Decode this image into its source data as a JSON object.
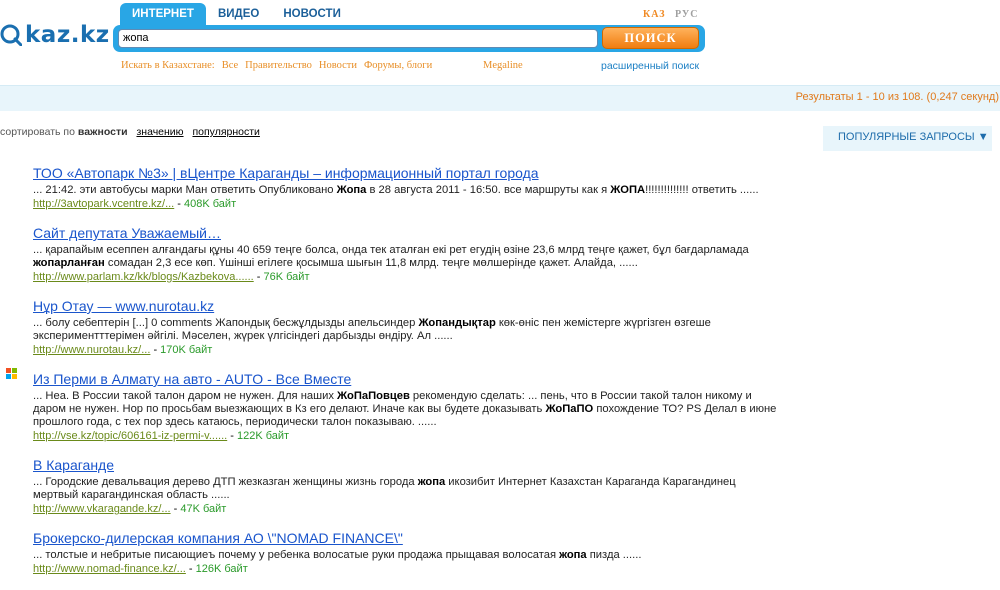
{
  "logo": {
    "text": "kaz.kz"
  },
  "tabs": [
    {
      "label": "ИНТЕРНЕТ",
      "active": true
    },
    {
      "label": "ВИДЕО",
      "active": false
    },
    {
      "label": "НОВОСТИ",
      "active": false
    }
  ],
  "languages": {
    "kaz": "КАЗ",
    "rus": "РУС"
  },
  "search": {
    "value": "жопа",
    "button_label": "ПОИСК"
  },
  "scope": {
    "prefix": "Искать в Казахстане:",
    "options": [
      "Все",
      "Правительство",
      "Новости",
      "Форумы, блоги"
    ],
    "megaline": "Megaline",
    "advanced": "расширенный поиск"
  },
  "results_info": "Результаты 1 - 10 из 108. (0,247 секунд)",
  "sort": {
    "prefix": "сортировать по",
    "current": "важности",
    "options": [
      "значению",
      "популярности"
    ]
  },
  "popular_queries": "ПОПУЛЯРНЫЕ ЗАПРОСЫ ▼",
  "results": [
    {
      "title": "ТОО «Автопарк №3» | вЦентре Караганды – информационный портал города",
      "snippet_html": "... 21:42. эти автобусы марки Ман ответить Опубликовано <b>Жопа</b> в 28 августа 2011 - 16:50. все маршруты как я <b>ЖОПА</b>!!!!!!!!!!!!!! ответить ......",
      "url": "http://3avtopark.vcentre.kz/...",
      "size": "408K байт"
    },
    {
      "title": "Сайт депутата Уважаемый…",
      "snippet_html": "... қарапайым есеппен алғандағы құны 40 659 теңге болса, онда тек аталған екі рет егудің өзіне 23,6 млрд теңге қажет, бұл бағдарламада <b>жопарланған</b> сомадан 2,3 есе көп. Үшінші егілеге қосымша шығын 11,8 млрд. теңге мөлшерінде қажет. Алайда, ......",
      "url": "http://www.parlam.kz/kk/blogs/Kazbekova......",
      "size": "76K байт"
    },
    {
      "title": "Нұр Отау — www.nurotau.kz",
      "snippet_html": "... болу себептерін [...] 0 comments Жапондық бесжұлдызды апельсиндер <b>Жопандықтар</b> көк-өніс пен жемістерге жүргізген өзгеше экспериментттерімен әйгілі. Мәселен, жүрек үлгісіндегі дарбызды өндіру. Ал ......",
      "url": "http://www.nurotau.kz/...",
      "size": "170K байт"
    },
    {
      "title": "Из Перми в Алмату на авто - AUTO - Все Вместе",
      "snippet_html": "... Неа. В России такой талон даром не нужен. Для наших <b>ЖоПаПовцев</b> рекомендую сделать: ... пень, что в России такой талон никому и даром не нужен. Нор по просьбам выезжающих в Кз его делают. Иначе как вы будете доказывать <b>ЖоПаПО</b> похождение ТО? PS Делал в июне прошлого года, с тех пор здесь катаюсь, периодически талон показываю. ......",
      "url": "http://vse.kz/topic/606161-iz-permi-v......",
      "size": "122K байт"
    },
    {
      "title": "В Караганде",
      "snippet_html": "... Городские девальвация дерево ДТП жезказган женщины жизнь города <b>жопа</b> икозибит Интернет Казахстан Караганда Карагандинец мертвый карагандинская область ......",
      "url": "http://www.vkaragande.kz/...",
      "size": "47K байт"
    },
    {
      "title": "Брокерско-дилерская компания АО \\\"NOMAD FINANCE\\\"",
      "snippet_html": "... толстые и небритые писающиеъ почему у ребенка волосатые руки продажа прыщавая волосатая <b>жопа</b> пизда ......",
      "url": "http://www.nomad-finance.kz/...",
      "size": "126K байт"
    }
  ],
  "colors": {
    "accent": "#29a6e5",
    "button": "#f07d10",
    "link": "#1a55cc",
    "url": "#6a8a1a",
    "size": "#2a9a2a",
    "highlight_text": "#e07a1c"
  }
}
